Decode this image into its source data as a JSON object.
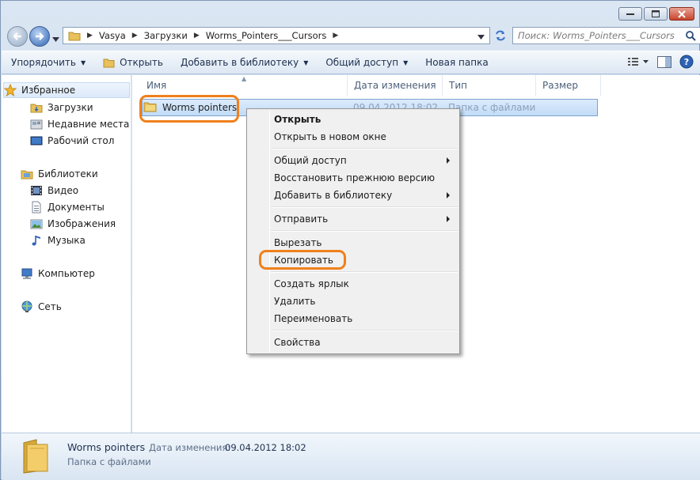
{
  "breadcrumb": [
    "Vasya",
    "Загрузки",
    "Worms_Pointers___Cursors"
  ],
  "search": {
    "placeholder": "Поиск: Worms_Pointers___Cursors"
  },
  "toolbar": {
    "organize": "Упорядочить",
    "open": "Открыть",
    "add_to_library": "Добавить в библиотеку",
    "share": "Общий доступ",
    "new_folder": "Новая папка"
  },
  "nav_pane": {
    "favorites": "Избранное",
    "downloads": "Загрузки",
    "recent": "Недавние места",
    "desktop": "Рабочий стол",
    "libraries": "Библиотеки",
    "video": "Видео",
    "documents": "Документы",
    "images": "Изображения",
    "music": "Музыка",
    "computer": "Компьютер",
    "network": "Сеть"
  },
  "columns": {
    "name": "Имя",
    "modified": "Дата изменения",
    "type": "Тип",
    "size": "Размер"
  },
  "file": {
    "name": "Worms pointers",
    "modified": "09.04.2012 18:02",
    "type": "Папка с файлами"
  },
  "context_menu": {
    "open": "Открыть",
    "open_new_window": "Открыть в новом окне",
    "share": "Общий доступ",
    "restore": "Восстановить прежнюю версию",
    "add_library": "Добавить в библиотеку",
    "send_to": "Отправить",
    "cut": "Вырезать",
    "copy": "Копировать",
    "shortcut": "Создать ярлык",
    "delete": "Удалить",
    "rename": "Переименовать",
    "properties": "Свойства"
  },
  "details": {
    "name": "Worms pointers",
    "modified_label": "Дата изменения:",
    "modified_value": "09.04.2012 18:02",
    "type": "Папка с файлами"
  },
  "colors": {
    "highlight": "#f0801c",
    "selection": "#c2dcf7"
  }
}
